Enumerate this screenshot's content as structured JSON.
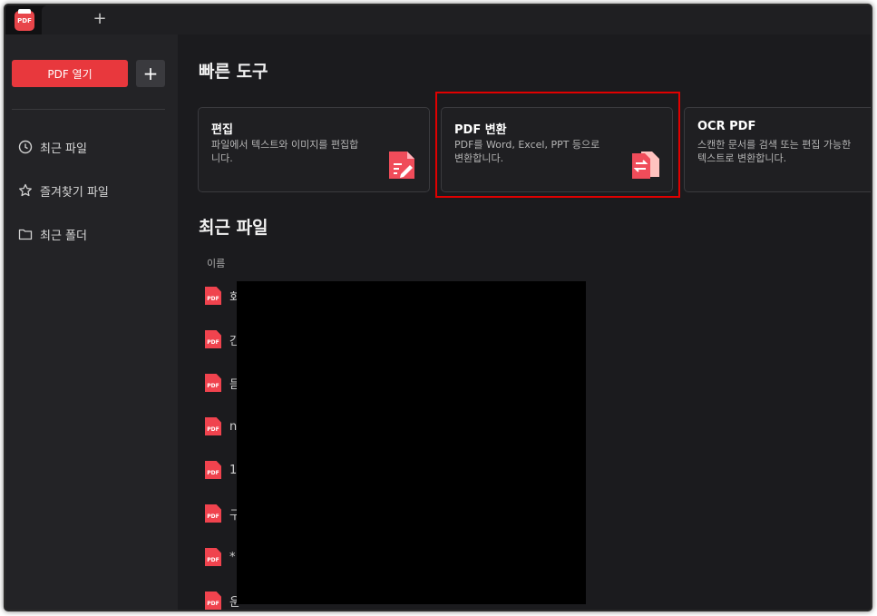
{
  "titlebar": {
    "app_logo_text": "PDF",
    "new_tab_label": "+"
  },
  "sidebar": {
    "open_button_label": "PDF 열기",
    "add_button_label": "+",
    "items": [
      {
        "label": "최근 파일",
        "icon": "clock-icon"
      },
      {
        "label": "즐겨찾기 파일",
        "icon": "star-icon"
      },
      {
        "label": "최근 폴더",
        "icon": "folder-icon"
      }
    ]
  },
  "quick_tools": {
    "title": "빠른 도구",
    "cards": [
      {
        "title": "편집",
        "description": "파일에서 텍스트와 이미지를 편집합니다.",
        "icon": "edit-icon"
      },
      {
        "title": "PDF 변환",
        "description": "PDF를 Word, Excel, PPT 등으로 변환합니다.",
        "icon": "convert-icon"
      },
      {
        "title": "OCR PDF",
        "description": "스캔한 문서를 검색 또는 편집 가능한 텍스트로 변환합니다.",
        "icon": "ocr-icon"
      }
    ]
  },
  "recent_files": {
    "title": "최근 파일",
    "column_name": "이름",
    "files": [
      {
        "name": "회",
        "icon_text": "PDF"
      },
      {
        "name": "간",
        "icon_text": "PDF"
      },
      {
        "name": "듣",
        "icon_text": "PDF"
      },
      {
        "name": "n",
        "icon_text": "PDF"
      },
      {
        "name": "1",
        "icon_text": "PDF"
      },
      {
        "name": "구",
        "icon_text": "PDF"
      },
      {
        "name": "*",
        "icon_text": "PDF"
      },
      {
        "name": "운",
        "icon_text": "PDF"
      }
    ]
  },
  "colors": {
    "accent": "#e8383d",
    "highlight_box": "#e00000",
    "background": "#1b1b1e",
    "sidebar": "#232326"
  }
}
